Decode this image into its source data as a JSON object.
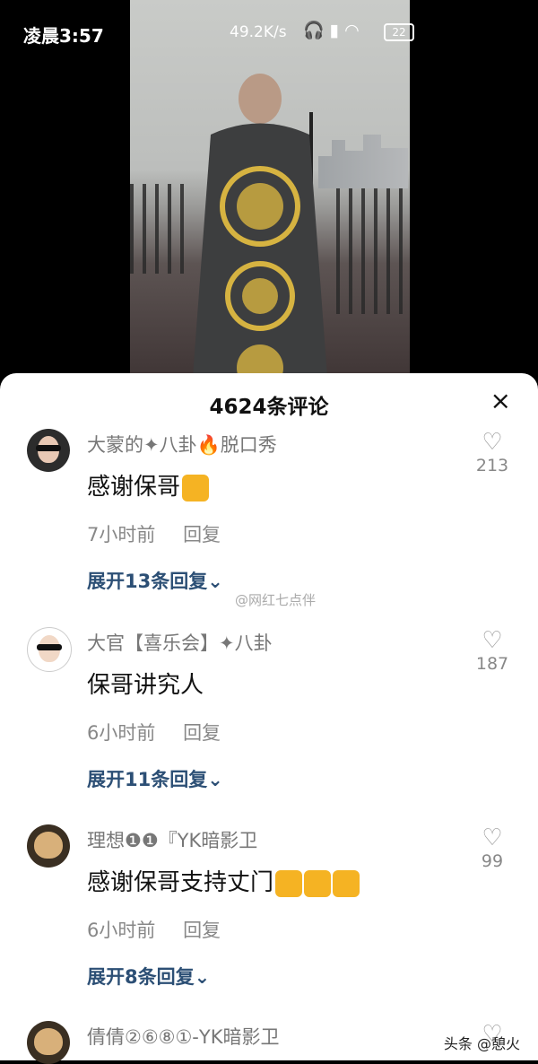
{
  "status_bar": {
    "time": "凌晨3:57",
    "network_speed": "49.2K/s",
    "icons": [
      "headphone-icon",
      "signal-icon",
      "wifi-icon"
    ],
    "battery": "22"
  },
  "sheet": {
    "title": "4624条评论",
    "close_glyph": "×"
  },
  "comments": [
    {
      "user": "大蒙的✦八卦🔥脱口秀",
      "text": "感谢保哥",
      "thumbs": 1,
      "time": "7小时前",
      "reply": "回复",
      "expand": "展开13条回复⌄",
      "likes": "213"
    },
    {
      "user": "大官【喜乐会】✦八卦",
      "text": "保哥讲究人",
      "thumbs": 0,
      "time": "6小时前",
      "reply": "回复",
      "expand": "展开11条回复⌄",
      "likes": "187"
    },
    {
      "user": "理想❶❶『YK暗影卫",
      "text": "感谢保哥支持丈门",
      "thumbs": 3,
      "time": "6小时前",
      "reply": "回复",
      "expand": "展开8条回复⌄",
      "likes": "99"
    },
    {
      "user": "倩倩②⑥⑧①-YK暗影卫",
      "text": "",
      "thumbs": 0,
      "time": "",
      "reply": "",
      "expand": "",
      "likes": ""
    }
  ],
  "watermarks": {
    "weibo": "@网红七点伴",
    "toutiao": "头条 @憩火"
  },
  "colors": {
    "expand_link": "#2c4f75",
    "thumb": "#f5b323"
  }
}
